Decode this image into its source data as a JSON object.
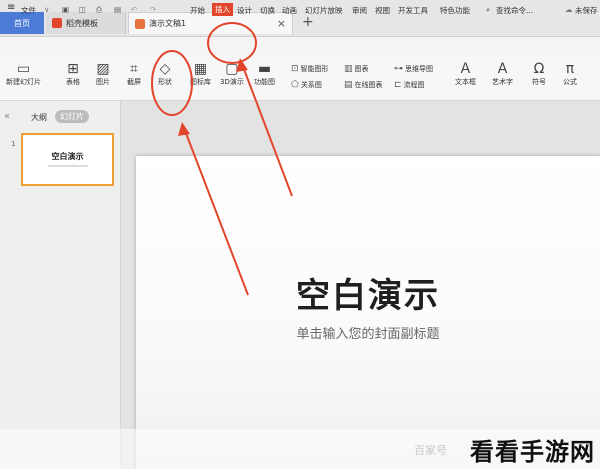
{
  "tabs": {
    "home": "首页",
    "template": "稻壳模板",
    "doc": "演示文稿1",
    "close": "×",
    "add": "+"
  },
  "menu": {
    "hamburger": "≡",
    "file": "文件",
    "file_arrow": "∨",
    "items": [
      "开始",
      "插入",
      "设计",
      "切换",
      "动画",
      "幻灯片放映",
      "审阅",
      "视图",
      "开发工具",
      "特色功能"
    ],
    "search": "查找命令...",
    "search_icon": "search-icon",
    "cloud": "未保存"
  },
  "ribbon": {
    "new_slide": "新建幻灯片",
    "table": "表格",
    "image": "图片",
    "screenshot": "截屏",
    "shape": "形状",
    "icon_lib": "图标库",
    "model3d": "3D演示",
    "funcgraph": "功能图",
    "smartgraph": "智能图形",
    "chart": "图表",
    "relation": "关系图",
    "online_chart": "在线图表",
    "mindmap": "思维导图",
    "flowchart": "流程图",
    "textbox": "文本框",
    "arttext": "艺术字",
    "symbol": "符号",
    "formula": "公式"
  },
  "panel": {
    "collapse": "«",
    "outline": "大纲",
    "slides": "幻灯片",
    "slide_number": "1",
    "thumb_title": "空白演示"
  },
  "slide": {
    "title": "空白演示",
    "subtitle": "单击输入您的封面副标题"
  },
  "watermark": {
    "small": "百家号",
    "brand": "看看手游网"
  },
  "colors": {
    "accent_red": "#e1462c",
    "home_tab": "#4b7bd6",
    "thumb_border": "#f0a030"
  }
}
